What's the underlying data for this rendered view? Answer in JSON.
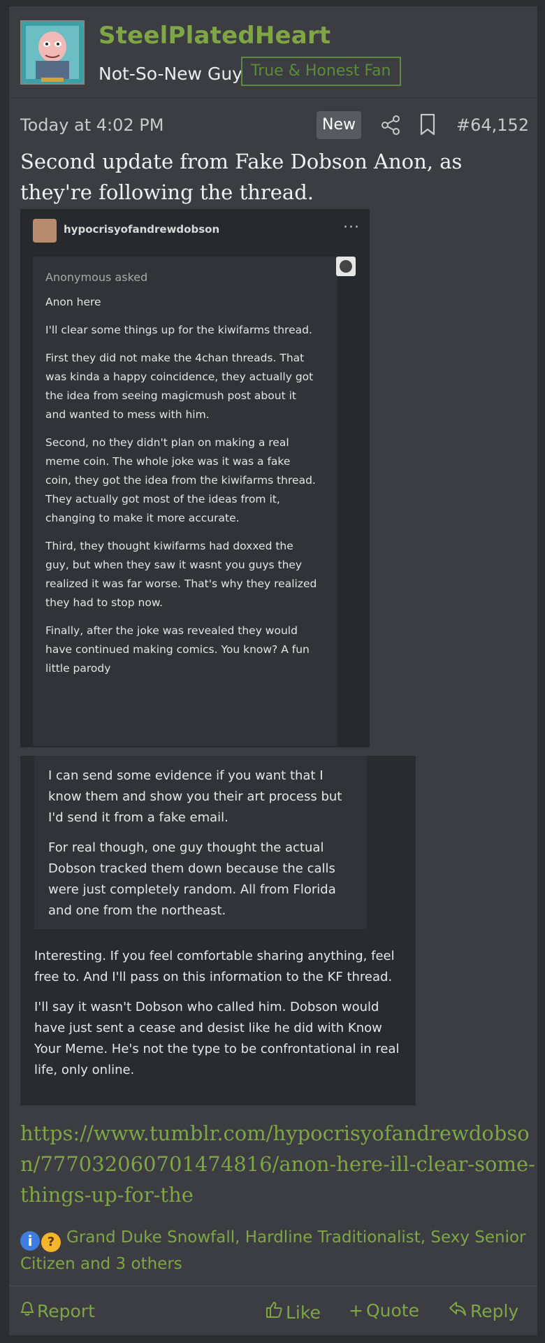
{
  "user": {
    "name": "SteelPlatedHeart",
    "title": "Not-So-New Guy",
    "banner": "True & Honest Fan"
  },
  "meta": {
    "timestamp": "Today at 4:02 PM",
    "badge": "New",
    "post_number": "#64,152"
  },
  "body": {
    "text": "Second update from Fake Dobson Anon, as they're following the thread."
  },
  "screenshot1": {
    "blog_name": "hypocrisyofandrewdobson",
    "more": "···",
    "asker": "Anonymous asked",
    "paragraphs": [
      "Anon here",
      "I'll clear some things up for the kiwifarms thread.",
      "First they did not make the 4chan threads. That was kinda a happy coincidence, they actually got the idea from seeing magicmush post about it and wanted to mess with him.",
      "Second, no they didn't plan on making a real meme coin.  The whole joke was it was a fake coin, they got the idea from the kiwifarms thread. They actually got most of the ideas from it, changing to make it more accurate.",
      "Third, they thought kiwifarms had doxxed the guy, but when they saw it wasnt you guys they realized it was far worse. That's why they realized they had to stop now.",
      "Finally, after the joke was revealed they would have continued making comics. You know? A fun little parody"
    ]
  },
  "screenshot2": {
    "inner_paragraphs": [
      "I can send some evidence if you want that I know them and show you their art process but I'd send it from a fake email.",
      "For real though,  one guy thought the actual Dobson tracked them down because the calls were just completely random. All from Florida and one from the northeast."
    ],
    "outer_paragraphs": [
      "Interesting. If you feel comfortable sharing anything, feel free to. And I'll pass on this information to the KF thread.",
      "I'll say it wasn't Dobson who called him. Dobson would have just sent a cease and desist like he did with Know Your Meme. He's not the type to be confrontational in real life, only online."
    ]
  },
  "link": {
    "url": "https://www.tumblr.com/hypocrisyofandrewdobson/777032060701474816/anon-here-ill-clear-some-things-up-for-the"
  },
  "reactions": {
    "info_icon": "i",
    "thinking_icon": "?",
    "text": "Grand Duke Snowfall, Hardline Traditionalist, Sexy Senior Citizen and 3 others"
  },
  "footer": {
    "report": "Report",
    "like": "Like",
    "quote": "Quote",
    "reply": "Reply"
  },
  "colors": {
    "accent": "#7fa545",
    "post_bg": "#3b3d42",
    "page_bg": "#2b2d31"
  }
}
